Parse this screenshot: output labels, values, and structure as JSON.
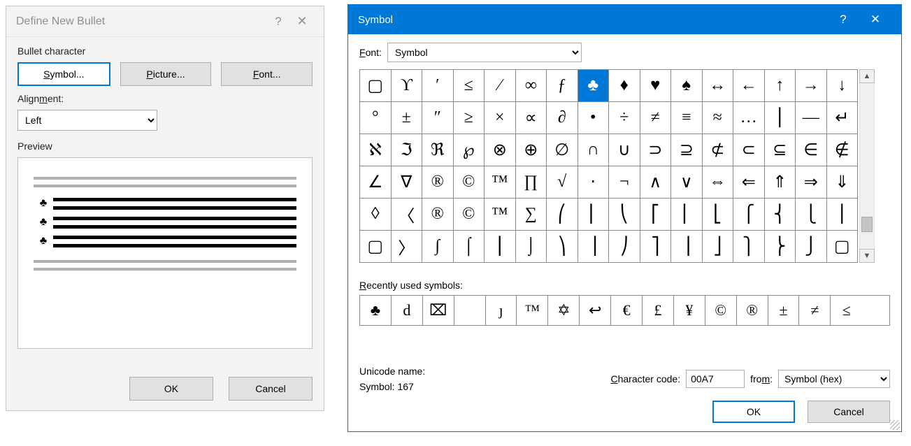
{
  "dlg1": {
    "title": "Define New Bullet",
    "section_bullet": "Bullet character",
    "symbol_btn": "Symbol...",
    "picture_btn": "Picture...",
    "font_btn": "Font...",
    "alignment_label": "Alignment:",
    "alignment_value": "Left",
    "preview_label": "Preview",
    "preview_bullet": "♣",
    "ok": "OK",
    "cancel": "Cancel"
  },
  "dlg2": {
    "title": "Symbol",
    "font_label": "Font:",
    "font_value": "Symbol",
    "grid": [
      [
        "▢",
        "ϒ",
        "′",
        "≤",
        "⁄",
        "∞",
        "ƒ",
        "♣",
        "♦",
        "♥",
        "♠",
        "↔",
        "←",
        "↑",
        "→",
        "↓"
      ],
      [
        "°",
        "±",
        "″",
        "≥",
        "×",
        "∝",
        "∂",
        "•",
        "÷",
        "≠",
        "≡",
        "≈",
        "…",
        "⎪",
        "—",
        "↵"
      ],
      [
        "ℵ",
        "ℑ",
        "ℜ",
        "℘",
        "⊗",
        "⊕",
        "∅",
        "∩",
        "∪",
        "⊃",
        "⊇",
        "⊄",
        "⊂",
        "⊆",
        "∈",
        "∉"
      ],
      [
        "∠",
        "∇",
        "®",
        "©",
        "™",
        "∏",
        "√",
        "⋅",
        "¬",
        "∧",
        "∨",
        "⇔",
        "⇐",
        "⇑",
        "⇒",
        "⇓"
      ],
      [
        "◊",
        "〈",
        "®",
        "©",
        "™",
        "∑",
        "⎛",
        "⎜",
        "⎝",
        "⎡",
        "⎢",
        "⎣",
        "⎧",
        "⎨",
        "⎩",
        "⎪"
      ],
      [
        "▢",
        "〉",
        "∫",
        "⌠",
        "⎮",
        "⌡",
        "⎞",
        "⎟",
        "⎠",
        "⎤",
        "⎥",
        "⎦",
        "⎫",
        "⎬",
        "⎭",
        "▢"
      ]
    ],
    "selected": {
      "row": 0,
      "col": 7
    },
    "recent_label": "Recently used symbols:",
    "recent": [
      "♣",
      "d",
      "⌧",
      " ",
      "ȷ",
      "™",
      "✡",
      "↩",
      "€",
      "£",
      "¥",
      "©",
      "®",
      "±",
      "≠",
      "≤"
    ],
    "unicode_label": "Unicode name:",
    "unicode_value": "Symbol: 167",
    "charcode_label": "Character code:",
    "charcode_value": "00A7",
    "from_label": "from:",
    "from_value": "Symbol (hex)",
    "ok": "OK",
    "cancel": "Cancel"
  }
}
